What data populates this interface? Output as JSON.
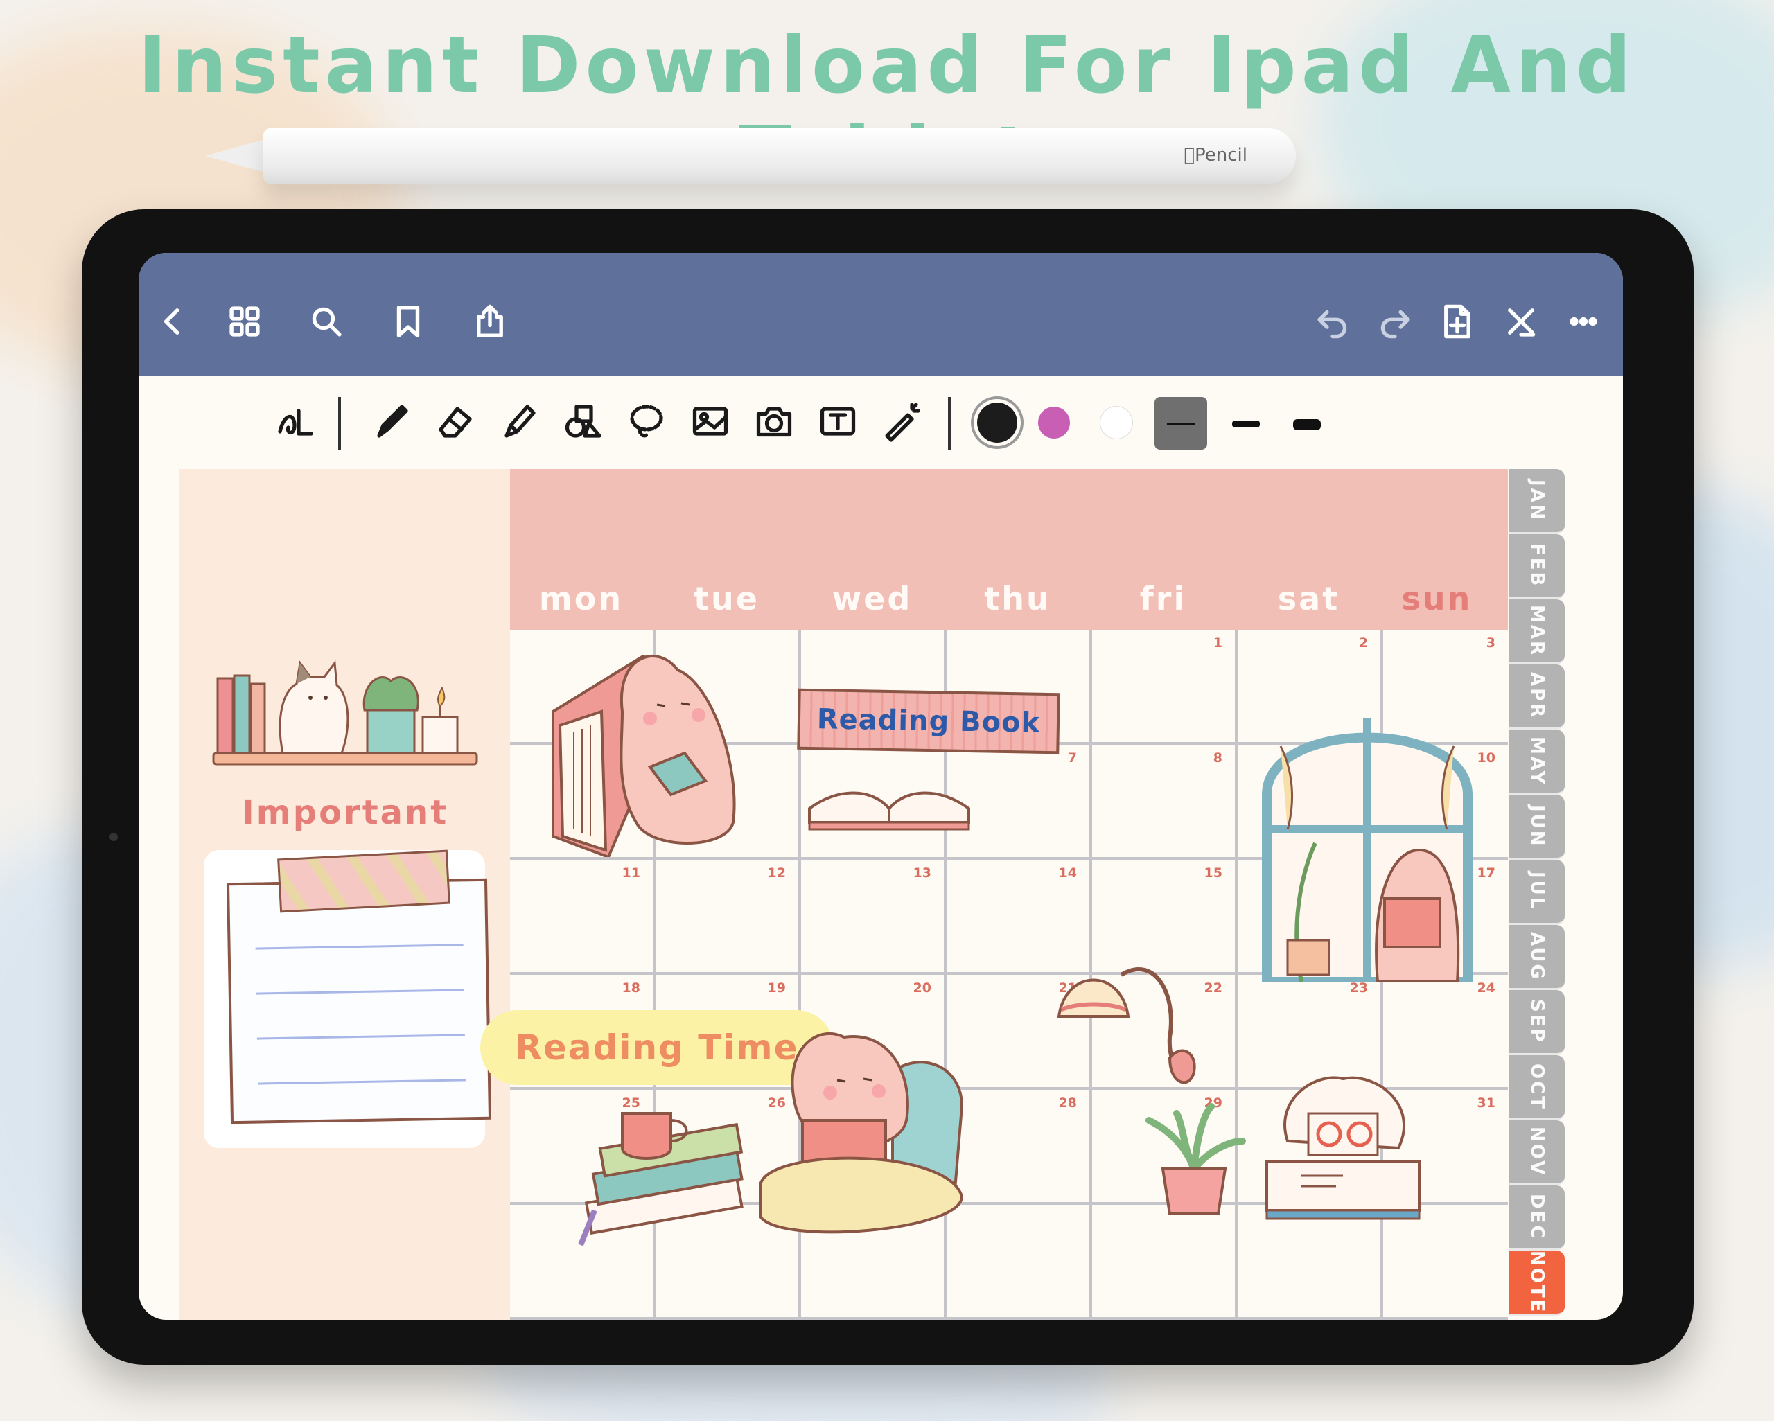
{
  "headline": "Instant Download For Ipad And Tablet",
  "pencil": {
    "label": "Pencil"
  },
  "topbar": {
    "icons": [
      "back-icon",
      "grid-icon",
      "search-icon",
      "bookmark-icon",
      "share-icon",
      "undo-icon",
      "redo-icon",
      "add-page-icon",
      "close-icon",
      "more-icon"
    ]
  },
  "toolbar": {
    "tools": [
      "handwriting-icon",
      "pen-icon",
      "eraser-icon",
      "highlighter-icon",
      "shapes-icon",
      "lasso-icon",
      "image-icon",
      "camera-icon",
      "text-icon",
      "laser-pointer-icon"
    ],
    "colors": [
      "#1c1c1c",
      "#c95fb5",
      "#ffffff"
    ],
    "selected_color": "#1c1c1c",
    "stroke_widths": [
      "thin",
      "medium",
      "thick"
    ],
    "selected_stroke": "thin"
  },
  "planner": {
    "side": {
      "important_label": "Important"
    },
    "days": [
      "mon",
      "tue",
      "wed",
      "thu",
      "fri",
      "sat",
      "sun"
    ],
    "weeks": [
      [
        "",
        "",
        "",
        "",
        "1",
        "2",
        "3"
      ],
      [
        "",
        "",
        "",
        "7",
        "8",
        "",
        "10"
      ],
      [
        "11",
        "12",
        "13",
        "14",
        "15",
        "",
        "17"
      ],
      [
        "18",
        "19",
        "20",
        "21",
        "22",
        "23",
        "24"
      ],
      [
        "25",
        "26",
        "",
        "28",
        "29",
        "",
        "31"
      ],
      [
        "",
        "",
        "",
        "",
        "",
        "",
        ""
      ]
    ],
    "tabs": [
      "JAN",
      "FEB",
      "MAR",
      "APR",
      "MAY",
      "JUN",
      "JUL",
      "AUG",
      "SEP",
      "OCT",
      "NOV",
      "DEC",
      "NOTE"
    ],
    "active_tab": "NOTE",
    "banners": {
      "reading_book": "Reading Book",
      "reading_time": "Reading Time"
    }
  },
  "colors": {
    "headline": "#7cc9aa",
    "topbar": "#5f709a",
    "calendar_header": "#f2bfb7",
    "side_panel": "#fcebdc",
    "tab_note": "#f2643f",
    "tab_default": "#b3b3b3"
  }
}
